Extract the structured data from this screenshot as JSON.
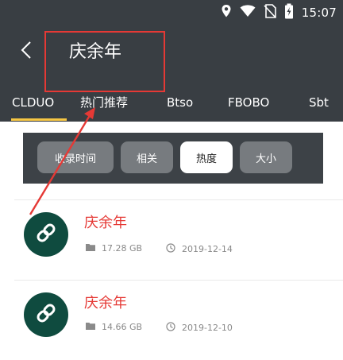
{
  "status_bar": {
    "time": "15:07",
    "icons": [
      "location-icon",
      "wifi-icon",
      "no-sim-icon",
      "battery-charging-icon"
    ]
  },
  "header": {
    "title": "庆余年",
    "back_icon": "chevron-left-icon"
  },
  "tabs": [
    {
      "label": "CLDUO",
      "active": true
    },
    {
      "label": "热门推荐",
      "active": false
    },
    {
      "label": "Btso",
      "active": false
    },
    {
      "label": "FBOBO",
      "active": false
    },
    {
      "label": "Sbt",
      "active": false
    }
  ],
  "sort_filters": [
    {
      "label": "收录时间",
      "active": false
    },
    {
      "label": "相关",
      "active": false
    },
    {
      "label": "热度",
      "active": true
    },
    {
      "label": "大小",
      "active": false
    }
  ],
  "results": [
    {
      "title": "庆余年",
      "size": "17.28 GB",
      "date": "2019-12-14",
      "icon": "link-icon"
    },
    {
      "title": "庆余年",
      "size": "14.66 GB",
      "date": "2019-12-10",
      "icon": "link-icon"
    }
  ],
  "colors": {
    "toolbar": "#393e43",
    "accent": "#f6c744",
    "title_red": "#e53935",
    "avatar_green": "#0f4b3f",
    "chip": "#777b7f",
    "annotation": "#e53935"
  }
}
